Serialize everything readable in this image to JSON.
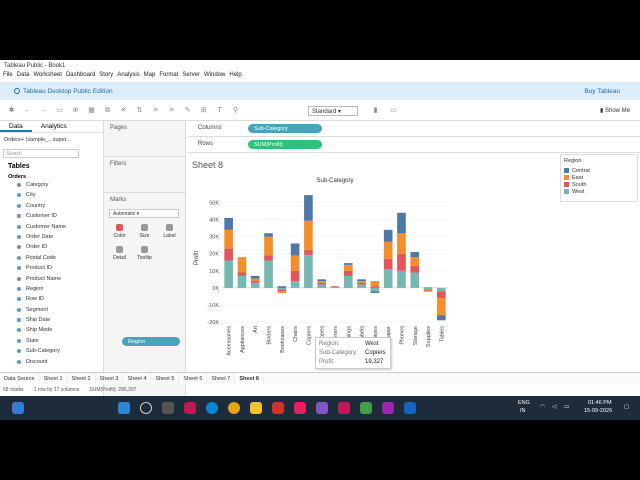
{
  "window": {
    "title": "Tableau Public - Book1"
  },
  "menu": [
    "File",
    "Data",
    "Worksheet",
    "Dashboard",
    "Story",
    "Analysis",
    "Map",
    "Format",
    "Server",
    "Window",
    "Help"
  ],
  "banner": {
    "text": "Tableau Desktop Public Edition",
    "buy": "Buy Tableau"
  },
  "toolbar": {
    "fit": "Standard",
    "show_me": "Show Me"
  },
  "left_tabs": [
    "Data",
    "Analytics"
  ],
  "data_source": "Orders+ (sample_...super...",
  "search_placeholder": "Search",
  "tables_title": "Tables",
  "table_name": "Orders",
  "fields": [
    "Category",
    "City",
    "Country",
    "Customer ID",
    "Customer Name",
    "Order Date",
    "Order ID",
    "Postal Code",
    "Product ID",
    "Product Name",
    "Region",
    "Row ID",
    "Segment",
    "Ship Date",
    "Ship Mode",
    "State",
    "Sub-Category",
    "Discount"
  ],
  "pages_title": "Pages",
  "filters_title": "Filters",
  "marks": {
    "title": "Marks",
    "type": "Automatic",
    "buttons": [
      "Color",
      "Size",
      "Label",
      "Detail",
      "Tooltip"
    ],
    "color_pill": "Region"
  },
  "shelves": {
    "columns_label": "Columns",
    "columns_pill": "Sub-Category",
    "rows_label": "Rows",
    "rows_pill": "SUM(Profit)"
  },
  "sheet_title": "Sheet 8",
  "legend": {
    "title": "Region",
    "items": [
      {
        "name": "Central",
        "color": "#4e79a7"
      },
      {
        "name": "East",
        "color": "#f28e2b"
      },
      {
        "name": "South",
        "color": "#e15759"
      },
      {
        "name": "West",
        "color": "#76b7b2"
      }
    ]
  },
  "chart_data": {
    "type": "bar",
    "stacked": true,
    "title": "Sub-Category",
    "ylabel": "Profit",
    "ylim": [
      -20000,
      55000
    ],
    "yticks": [
      -20000,
      -10000,
      0,
      10000,
      20000,
      30000,
      40000,
      50000
    ],
    "ytick_labels": [
      "-20K",
      "-10K",
      "0K",
      "10K",
      "20K",
      "30K",
      "40K",
      "50K"
    ],
    "categories": [
      "Accessories",
      "Appliances",
      "Art",
      "Binders",
      "Bookcases",
      "Chairs",
      "Copiers",
      "Envelopes",
      "Fasteners",
      "Furnishings",
      "Labels",
      "Machines",
      "Paper",
      "Phones",
      "Storage",
      "Supplies",
      "Tables"
    ],
    "series": [
      {
        "name": "West",
        "color": "#76b7b2",
        "values": [
          16000,
          7000,
          3000,
          16000,
          -1000,
          4000,
          19327,
          2000,
          300,
          7000,
          2000,
          -2000,
          11000,
          10000,
          9000,
          -1000,
          -2000
        ]
      },
      {
        "name": "South",
        "color": "#e15759",
        "values": [
          7000,
          2000,
          1000,
          3000,
          -1000,
          6000,
          3000,
          1000,
          300,
          3000,
          1000,
          1000,
          6000,
          10000,
          4000,
          -500,
          -4000
        ]
      },
      {
        "name": "East",
        "color": "#f28e2b",
        "values": [
          11000,
          9000,
          1500,
          11000,
          -1000,
          9000,
          17000,
          1000,
          300,
          3500,
          1000,
          3000,
          10000,
          12000,
          5000,
          -800,
          -10000
        ]
      },
      {
        "name": "Central",
        "color": "#4e79a7",
        "values": [
          7000,
          0,
          1500,
          2000,
          1000,
          7000,
          15000,
          1000,
          200,
          1000,
          1000,
          -1000,
          7000,
          12000,
          3000,
          300,
          -3000
        ]
      }
    ]
  },
  "tooltip": {
    "rows": [
      {
        "k": "Region:",
        "v": "West"
      },
      {
        "k": "Sub-Category:",
        "v": "Copiers"
      },
      {
        "k": "Profit:",
        "v": "19,327"
      }
    ]
  },
  "sheet_tabs": [
    "Data Source",
    "Sheet 1",
    "Sheet 2",
    "Sheet 3",
    "Sheet 4",
    "Sheet 5",
    "Sheet 6",
    "Sheet 7",
    "Sheet 8"
  ],
  "active_sheet": "Sheet 8",
  "status": {
    "marks": "68 marks",
    "rows": "1 row by 17 columns",
    "sum": "SUM(Profit): 286,397"
  },
  "taskbar": {
    "lang": "ENG",
    "region": "IN",
    "time": "01:46 PM",
    "date": "15-09-2026"
  }
}
